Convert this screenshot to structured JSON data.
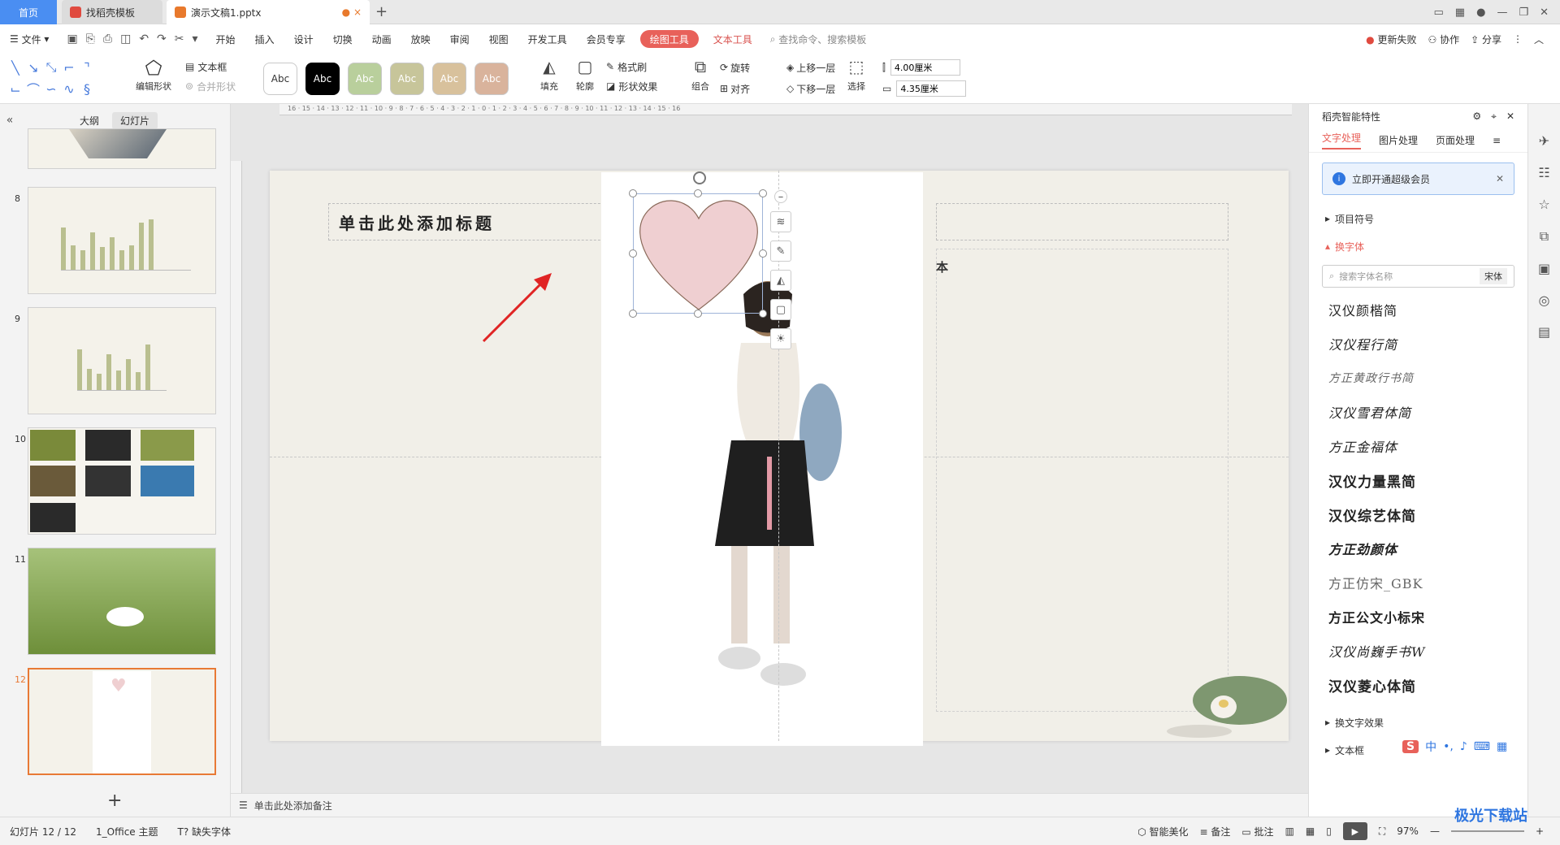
{
  "titlebar": {
    "home": "首页",
    "template_tab": "找稻壳模板",
    "doc_tab": "演示文稿1.pptx",
    "new_tab": "+"
  },
  "menubar": {
    "file": "文件",
    "items": [
      "开始",
      "插入",
      "设计",
      "切换",
      "动画",
      "放映",
      "审阅",
      "视图",
      "开发工具",
      "会员专享"
    ],
    "active": "绘图工具",
    "text_tools": "文本工具",
    "search": "查找命令、搜索模板",
    "right": [
      "更新失败",
      "协作",
      "分享"
    ]
  },
  "ribbon": {
    "edit_shape": "编辑形状",
    "text_box": "文本框",
    "merge_shape": "合并形状",
    "style_labels": [
      "Abc",
      "Abc",
      "Abc",
      "Abc",
      "Abc",
      "Abc"
    ],
    "style_colors": [
      "#ffffff",
      "#000000",
      "#b9cf9c",
      "#c7c59a",
      "#d8c19c",
      "#d9b39c"
    ],
    "fill": "填充",
    "outline": "轮廓",
    "format_painter": "格式刷",
    "shape_effect": "形状效果",
    "group": "组合",
    "rotate": "旋转",
    "align": "对齐",
    "bring_forward": "上移一层",
    "send_backward": "下移一层",
    "select": "选择",
    "height": "4.00厘米",
    "width": "4.35厘米"
  },
  "leftpanel": {
    "tab_outline": "大纲",
    "tab_slides": "幻灯片",
    "slides": [
      "8",
      "9",
      "10",
      "11",
      "12"
    ]
  },
  "slide": {
    "title_placeholder": "单击此处添加标题",
    "body_text": "本",
    "heart_color": "#efcfd1"
  },
  "rightpanel": {
    "title": "稻壳智能特性",
    "tabs": [
      "文字处理",
      "图片处理",
      "页面处理"
    ],
    "vip": "立即开通超级会员",
    "bullets": "项目符号",
    "change_font": "换字体",
    "font_search": "搜索字体名称",
    "current_font": "宋体",
    "fonts": [
      "汉仪颜楷简",
      "汉仪程行简",
      "方正黄政行书简",
      "汉仪雪君体简",
      "方正金福体",
      "汉仪力量黑简",
      "汉仪综艺体简",
      "方正劲颜体",
      "方正仿宋_GBK",
      "方正公文小标宋",
      "汉仪尚巍手书W",
      "汉仪菱心体简"
    ],
    "text_effect": "换文字效果",
    "textbox": "文本框"
  },
  "notes": "单击此处添加备注",
  "status": {
    "slide": "幻灯片 12 / 12",
    "theme": "1_Office 主题",
    "missing_font": "缺失字体",
    "smart": "智能美化",
    "notes": "备注",
    "comments": "批注",
    "zoom": "97%"
  },
  "watermark": "极光下载站"
}
